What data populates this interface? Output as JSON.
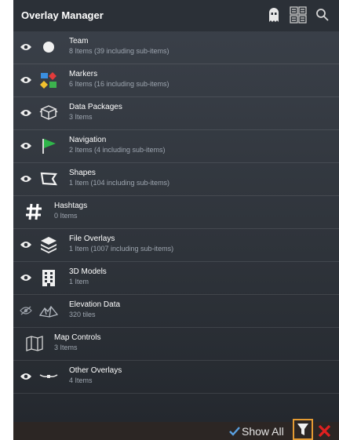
{
  "app": {
    "title": "Overlay Manager"
  },
  "colors": {
    "accent": "#e49b33",
    "close": "#e02020",
    "green": "#2fb64a",
    "check": "#5aa0e0"
  },
  "toolbar": {
    "icons": [
      "ghost-icon",
      "grid-view-icon",
      "search-icon"
    ]
  },
  "items": [
    {
      "name": "Team",
      "sub": "8 Items (39 including sub-items)"
    },
    {
      "name": "Markers",
      "sub": "6 Items (16 including sub-items)"
    },
    {
      "name": "Data Packages",
      "sub": "3 Items"
    },
    {
      "name": "Navigation",
      "sub": "2 Items (4 including sub-items)"
    },
    {
      "name": "Shapes",
      "sub": "1 Item (104 including sub-items)"
    },
    {
      "name": "Hashtags",
      "sub": "0 Items"
    },
    {
      "name": "File Overlays",
      "sub": "1 Item (1007 including sub-items)"
    },
    {
      "name": "3D Models",
      "sub": "1 Item"
    },
    {
      "name": "Elevation Data",
      "sub": "320 tiles"
    },
    {
      "name": "Map Controls",
      "sub": "3 Items"
    },
    {
      "name": "Other Overlays",
      "sub": "4 Items"
    }
  ],
  "bottom": {
    "show_all_label": "Show All",
    "show_all_checked": true
  }
}
